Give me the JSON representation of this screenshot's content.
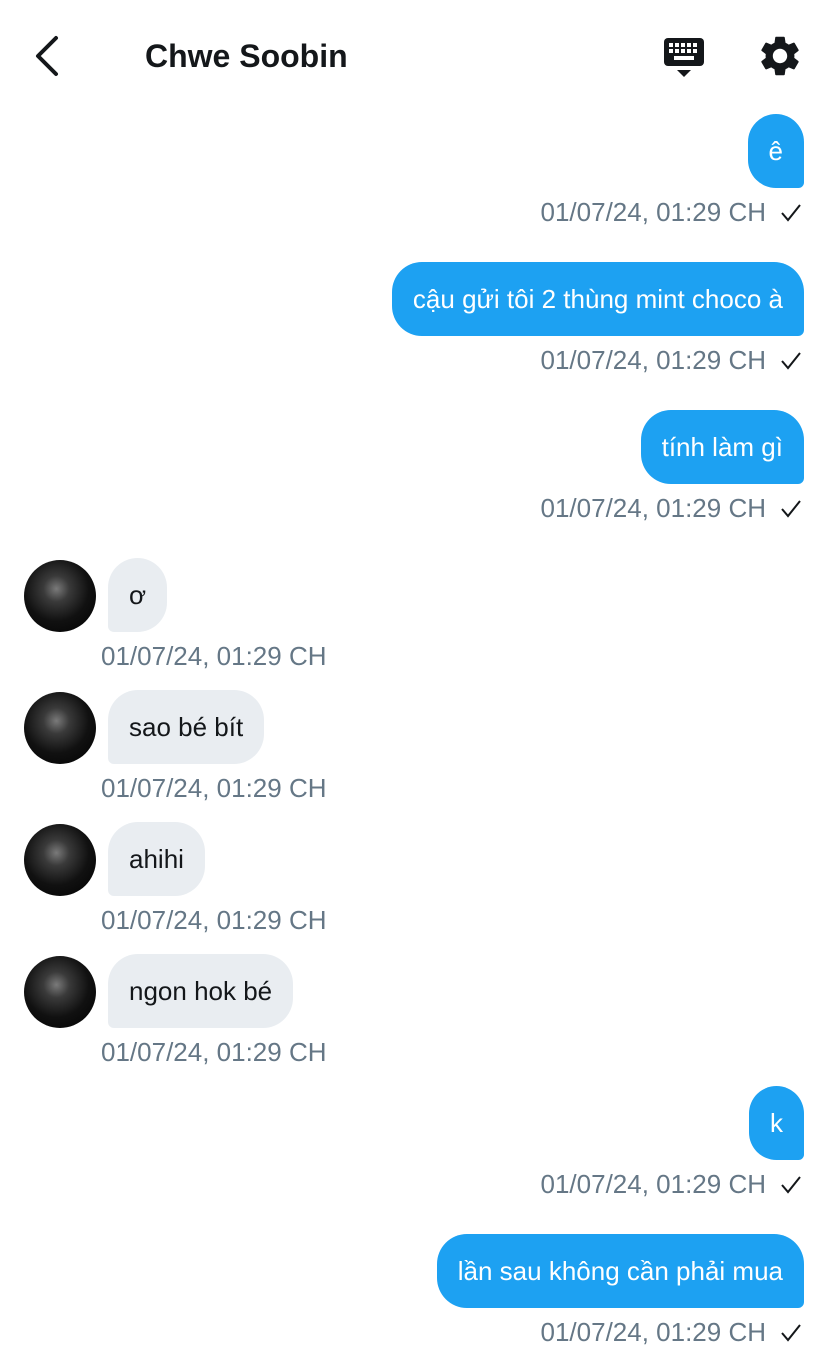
{
  "header": {
    "title": "Chwe Soobin",
    "back_icon": "chevron-left-icon",
    "keyboard_icon": "keyboard-icon",
    "settings_icon": "gear-icon"
  },
  "colors": {
    "outgoing_bubble": "#1da1f2",
    "incoming_bubble": "#e9edf1",
    "timestamp": "#657786"
  },
  "messages": [
    {
      "direction": "out",
      "text": "ê",
      "time": "01/07/24, 01:29 CH",
      "read": true
    },
    {
      "direction": "out",
      "text": "cậu gửi tôi 2 thùng mint choco à",
      "time": "01/07/24, 01:29 CH",
      "read": true
    },
    {
      "direction": "out",
      "text": "tính làm gì",
      "time": "01/07/24, 01:29 CH",
      "read": true
    },
    {
      "direction": "in",
      "text": "ơ",
      "time": "01/07/24, 01:29 CH"
    },
    {
      "direction": "in",
      "text": "sao bé bít",
      "time": "01/07/24, 01:29 CH"
    },
    {
      "direction": "in",
      "text": "ahihi",
      "time": "01/07/24, 01:29 CH"
    },
    {
      "direction": "in",
      "text": "ngon hok bé",
      "time": "01/07/24, 01:29 CH"
    },
    {
      "direction": "out",
      "text": "k",
      "time": "01/07/24, 01:29 CH",
      "read": true
    },
    {
      "direction": "out",
      "text": "lần sau không cần phải mua",
      "time": "01/07/24, 01:29 CH",
      "read": true
    }
  ]
}
